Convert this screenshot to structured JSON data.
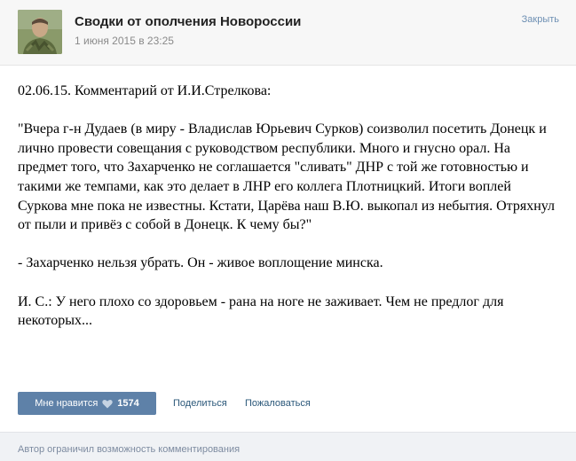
{
  "header": {
    "avatar_icon": "avatar-photo-icon",
    "group_name": "Сводки от ополчения Новороссии",
    "date": "1 июня 2015 в 23:25",
    "close_label": "Закрыть"
  },
  "post": {
    "paragraphs": [
      "02.06.15. Комментарий от И.И.Стрелкова:",
      "\"Вчера г-н Дудаев (в миру - Владислав Юрьевич Сурков) соизволил посетить Донецк и лично провести совещания с руководством республики. Много и гнусно орал. На предмет того, что Захарченко не соглашается \"сливать\" ДНР с той же готовностью и такими же темпами, как это делает в ЛНР его коллега Плотницкий. Итоги воплей Суркова мне пока не известны. Кстати, Царёва наш В.Ю. выкопал из небытия. Отряхнул от пыли и привёз с собой в Донецк. К чему бы?\"",
      "- Захарченко нельзя убрать. Он - живое воплощение минска.",
      "И. С.: У него плохо со здоровьем - рана на ноге не заживает. Чем не предлог для некоторых..."
    ]
  },
  "actions": {
    "like_label": "Мне нравится",
    "like_icon": "heart-icon",
    "like_count": "1574",
    "share_label": "Поделиться",
    "report_label": "Пожаловаться"
  },
  "footer": {
    "text": "Автор ограничил возможность комментирования"
  },
  "colors": {
    "like_button": "#5e81a8",
    "link": "#2b587a",
    "close_link": "#6d8fb3",
    "footer_bg": "#f0f2f5"
  }
}
